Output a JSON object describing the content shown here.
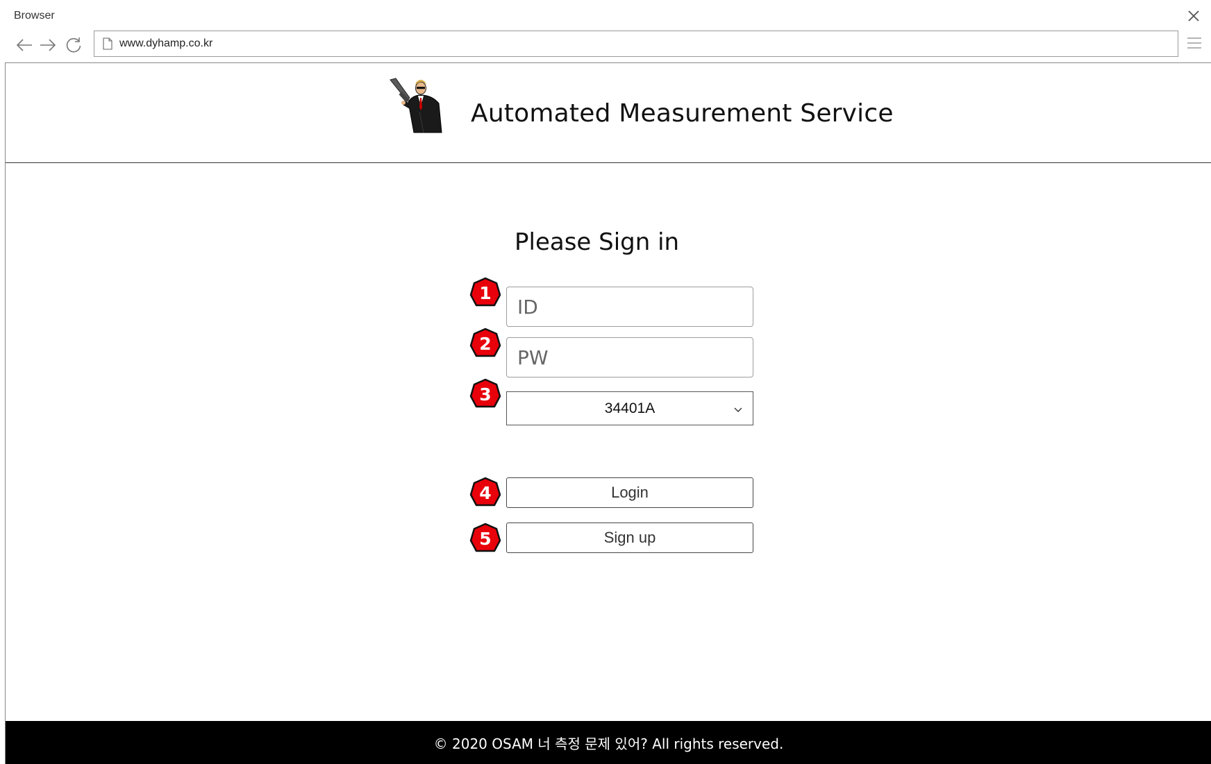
{
  "browser": {
    "title": "Browser",
    "url": "www.dyhamp.co.kr"
  },
  "header": {
    "site_title": "Automated Measurement Service",
    "logo_icon": "agent-with-gun-logo"
  },
  "form": {
    "heading": "Please Sign in",
    "id_placeholder": "ID",
    "pw_placeholder": "PW",
    "unit_select_value": "34401A",
    "login_label": "Login",
    "signup_label": "Sign up"
  },
  "markers": [
    "1",
    "2",
    "3",
    "4",
    "5"
  ],
  "footer": {
    "text": "© 2020 OSAM 너 측정 문제 있어? All rights reserved."
  },
  "colors": {
    "marker_fill": "#e8000b",
    "footer_bg": "#000000"
  }
}
